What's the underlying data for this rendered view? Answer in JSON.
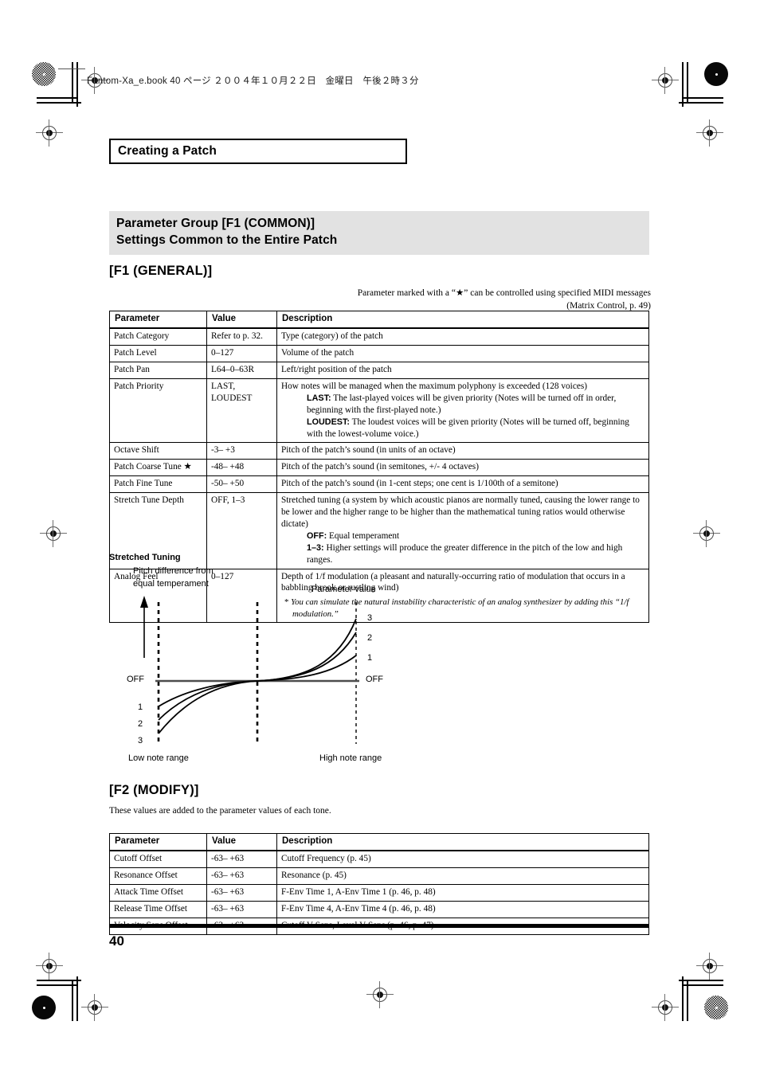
{
  "document_header": "Fantom-Xa_e.book 40 ページ  ２００４年１０月２２日　金曜日　午後２時３分",
  "chapter_title": "Creating a Patch",
  "group_band": {
    "line1": "Parameter Group [F1 (COMMON)]",
    "line2": "Settings Common to the Entire Patch"
  },
  "section_f1": {
    "heading": "[F1 (GENERAL)]",
    "note_line1": "Parameter marked with a “★” can be controlled using specified MIDI messages",
    "note_line2": "(Matrix Control, p. 49)",
    "columns": [
      "Parameter",
      "Value",
      "Description"
    ],
    "rows": [
      {
        "parameter": "Patch Category",
        "value": "Refer to p. 32.",
        "description": "Type (category) of the patch"
      },
      {
        "parameter": "Patch Level",
        "value": "0–127",
        "description": "Volume of the patch"
      },
      {
        "parameter": "Patch Pan",
        "value": "L64–0–63R",
        "description": "Left/right position of the patch"
      },
      {
        "parameter": "Patch Priority",
        "value": "LAST, LOUDEST",
        "description": "How notes will be managed when the maximum polyphony is exceeded (128 voices)",
        "definitions": [
          {
            "term": "LAST:",
            "text": " The last-played voices will be given priority (Notes will be turned off in order, beginning with the first-played note.)"
          },
          {
            "term": "LOUDEST:",
            "text": " The loudest voices will be given priority (Notes will be turned off, beginning with the lowest-volume voice.)"
          }
        ]
      },
      {
        "parameter": "Octave Shift",
        "value": "-3– +3",
        "description": "Pitch of the patch’s sound (in units of an octave)"
      },
      {
        "parameter": "Patch Coarse Tune ★",
        "value": "-48– +48",
        "description": "Pitch of the patch’s sound (in semitones, +/- 4 octaves)"
      },
      {
        "parameter": "Patch Fine Tune",
        "value": "-50– +50",
        "description": "Pitch of the patch’s sound (in 1-cent steps; one cent is 1/100th of a semitone)"
      },
      {
        "parameter": "Stretch Tune Depth",
        "value": "OFF, 1–3",
        "description": "Stretched tuning (a system by which acoustic pianos are normally tuned, causing the lower range to be lower and the higher range to be higher than the mathematical tuning ratios would otherwise dictate)",
        "definitions": [
          {
            "term": "OFF:",
            "text": " Equal temperament"
          },
          {
            "term": "1–3:",
            "text": " Higher settings will produce the greater difference in the pitch of the low and high ranges."
          }
        ]
      },
      {
        "parameter": "Analog Feel",
        "value": "0–127",
        "description": "Depth of 1/f modulation (a pleasant and naturally-occurring ratio of modulation that occurs in a babbling brook or rustling wind)",
        "footnote": "You can simulate the natural instability characteristic of an analog synthesizer by adding this “1/f modulation.”"
      }
    ]
  },
  "figure": {
    "caption": "Stretched Tuning",
    "y_axis_label_line1": "Pitch difference from",
    "y_axis_label_line2": "equal temperament",
    "param_value_label": "Parameter value",
    "left_off_label": "OFF",
    "right_off_label": "OFF",
    "left_ticks": [
      "1",
      "2",
      "3"
    ],
    "right_ticks": [
      "3",
      "2",
      "1"
    ],
    "bottom_left_label": "Low note range",
    "bottom_right_label": "High note range"
  },
  "section_f2": {
    "heading": "[F2 (MODIFY)]",
    "intro": "These values are added to the parameter values of each tone.",
    "columns": [
      "Parameter",
      "Value",
      "Description"
    ],
    "rows": [
      {
        "parameter": "Cutoff Offset",
        "value": "-63– +63",
        "description": "Cutoff Frequency (p. 45)"
      },
      {
        "parameter": "Resonance Offset",
        "value": "-63– +63",
        "description": "Resonance (p. 45)"
      },
      {
        "parameter": "Attack Time Offset",
        "value": "-63– +63",
        "description": "F-Env Time 1, A-Env Time 1 (p. 46, p. 48)"
      },
      {
        "parameter": "Release Time Offset",
        "value": "-63– +63",
        "description": "F-Env Time 4, A-Env Time 4 (p. 46, p. 48)"
      },
      {
        "parameter": "Velocity Sens Offset",
        "value": "-63– +63",
        "description": "Cutoff V-Sens, Level V-Sens (p. 46, p. 47)"
      }
    ]
  },
  "footer": {
    "page_number": "40"
  }
}
